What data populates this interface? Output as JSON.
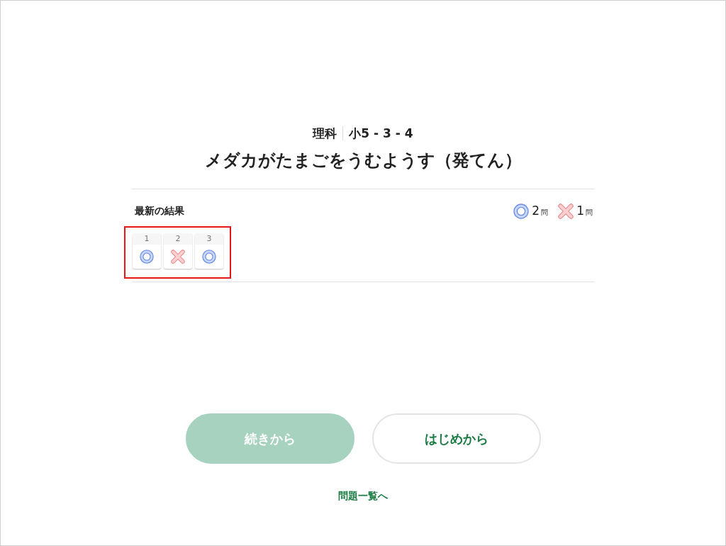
{
  "header": {
    "subject": "理科",
    "unit_code": "小5 - 3 - 4",
    "title": "メダカがたまごをうむようす（発てん）"
  },
  "latest_results": {
    "label": "最新の結果",
    "summary": [
      {
        "kind": "correct",
        "count": "2",
        "unit": "問"
      },
      {
        "kind": "wrong",
        "count": "1",
        "unit": "問"
      }
    ],
    "highlighted": true,
    "questions": [
      {
        "number": "1",
        "kind": "correct"
      },
      {
        "number": "2",
        "kind": "wrong"
      },
      {
        "number": "3",
        "kind": "correct"
      }
    ]
  },
  "buttons": [
    {
      "label": "続きから",
      "disabled": true
    },
    {
      "label": "はじめから",
      "disabled": false
    }
  ],
  "link": "問題一覧へ"
}
